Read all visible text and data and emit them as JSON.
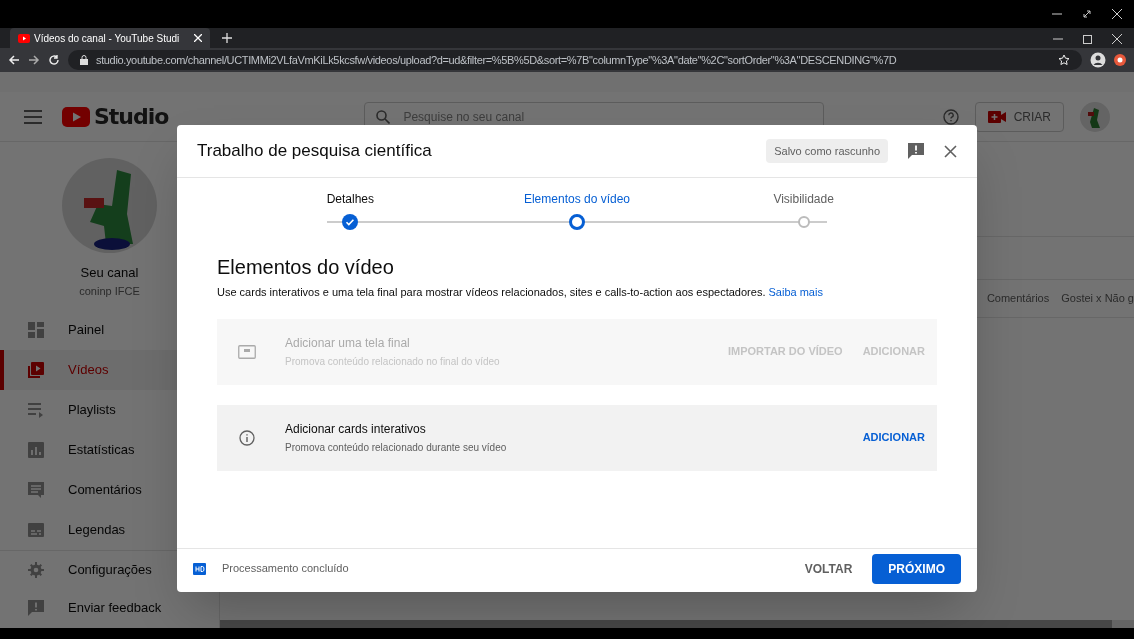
{
  "browser": {
    "tab": {
      "title": "Vídeos do canal - YouTube Studi"
    },
    "address": "studio.youtube.com/channel/UCTIMMi2VLfaVmKiLk5kcsfw/videos/upload?d=ud&filter=%5B%5D&sort=%7B\"columnType\"%3A\"date\"%2C\"sortOrder\"%3A\"DESCENDING\"%7D"
  },
  "header": {
    "logo": "Studio",
    "search": {
      "placeholder": "Pesquise no seu canal"
    },
    "create_button": "CRIAR"
  },
  "sidebar": {
    "channel": {
      "name": "Seu canal",
      "handle": "coninp IFCE"
    },
    "items": [
      {
        "label": "Painel",
        "kind": "dashboard",
        "selected": false
      },
      {
        "label": "Vídeos",
        "kind": "videos",
        "selected": true
      },
      {
        "label": "Playlists",
        "kind": "playlists",
        "selected": false
      },
      {
        "label": "Estatísticas",
        "kind": "analytics",
        "selected": false
      },
      {
        "label": "Comentários",
        "kind": "comments",
        "selected": false
      },
      {
        "label": "Legendas",
        "kind": "subtitles",
        "selected": false
      }
    ],
    "footer_items": [
      {
        "label": "Configurações",
        "kind": "settings"
      },
      {
        "label": "Enviar feedback",
        "kind": "feedback"
      }
    ]
  },
  "table": {
    "columns": [
      "Comentários",
      "Gostei x Não g"
    ]
  },
  "dialog": {
    "title": "Trabalho de pesquisa científica",
    "draft_badge": "Salvo como rascunho",
    "steps": [
      {
        "label": "Detalhes",
        "completed": true,
        "selected": false
      },
      {
        "label": "Elementos do vídeo",
        "completed": false,
        "selected": true
      },
      {
        "label": "Visibilidade",
        "completed": false,
        "selected": false
      }
    ],
    "heading": "Elementos do vídeo",
    "description": "Use cards interativos e uma tela final para mostrar vídeos relacionados, sites e calls-to-action aos espectadores.",
    "learn_more": "Saiba mais",
    "cards": [
      {
        "kind": "end_screen",
        "title": "Adicionar uma tela final",
        "subtitle": "Promova conteúdo relacionado no final do vídeo",
        "disabled": true,
        "actions": [
          "IMPORTAR DO VÍDEO",
          "ADICIONAR"
        ]
      },
      {
        "kind": "info_cards",
        "title": "Adicionar cards interativos",
        "subtitle": "Promova conteúdo relacionado durante seu vídeo",
        "disabled": false,
        "actions": [
          "ADICIONAR"
        ]
      }
    ],
    "status": "Processamento concluído",
    "back_button": "VOLTAR",
    "next_button": "PRÓXIMO"
  }
}
